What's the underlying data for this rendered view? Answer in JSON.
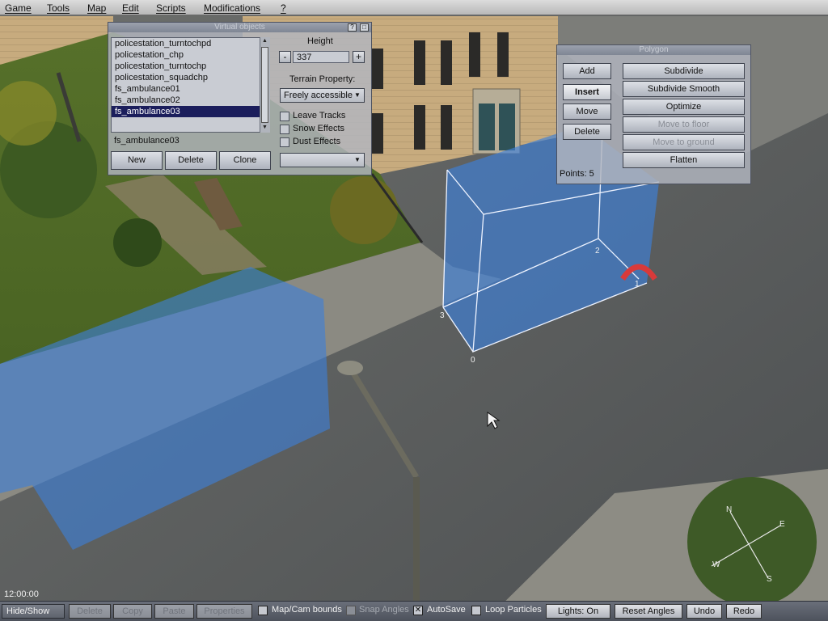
{
  "menu": [
    "Game",
    "Tools",
    "Map",
    "Edit",
    "Scripts",
    "Modifications",
    "?"
  ],
  "virtual_objects": {
    "title": "Virtual objects",
    "help_label": "?",
    "close_label": "□",
    "list_items": [
      "policestation_turntochpd",
      "policestation_chp",
      "policestation_turntochp",
      "policestation_squadchp",
      "fs_ambulance01",
      "fs_ambulance02",
      "fs_ambulance03"
    ],
    "selected_index": 6,
    "selected_name": "fs_ambulance03",
    "buttons": {
      "new": "New",
      "delete": "Delete",
      "clone": "Clone"
    },
    "height_label": "Height",
    "height_value": "337",
    "minus_label": "-",
    "plus_label": "+",
    "terrain_label": "Terrain Property:",
    "terrain_value": "Freely accessible",
    "dropdown_arrow": "▼",
    "checkboxes": {
      "leave_tracks": "Leave Tracks",
      "snow_effects": "Snow Effects",
      "dust_effects": "Dust Effects"
    },
    "effect_dropdown_value": ""
  },
  "polygon": {
    "title": "Polygon",
    "buttons": {
      "add": "Add",
      "insert": "Insert",
      "move": "Move",
      "delete": "Delete",
      "subdivide": "Subdivide",
      "subdivide_smooth": "Subdivide Smooth",
      "optimize": "Optimize",
      "move_to_floor": "Move to floor",
      "move_to_ground": "Move to ground",
      "flatten": "Flatten"
    },
    "points_text": "Points: 5"
  },
  "scene": {
    "time": "12:00:00",
    "vertex_labels": [
      "0",
      "1",
      "2",
      "3"
    ],
    "compass": {
      "n": "N",
      "e": "E",
      "s": "S",
      "w": "W"
    }
  },
  "bottom_bar": {
    "hide_show": "Hide/Show",
    "delete": "Delete",
    "copy": "Copy",
    "paste": "Paste",
    "properties": "Properties",
    "map_cam_bounds": "Map/Cam bounds",
    "snap_angles": "Snap Angles",
    "autosave": "AutoSave",
    "autosave_check": "✕",
    "loop_particles": "Loop Particles",
    "lights": "Lights: On",
    "reset_angles": "Reset Angles",
    "undo": "Undo",
    "redo": "Redo"
  },
  "colors": {
    "selection": "#1b1e5c",
    "volume_fill": "#3d7fd8",
    "asphalt": "#5a5d5e",
    "grass": "#4f6a24"
  }
}
